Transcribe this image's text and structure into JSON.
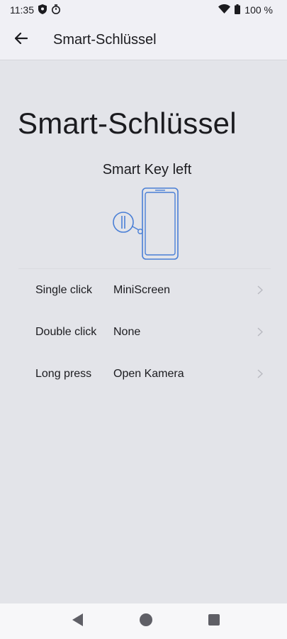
{
  "status_bar": {
    "time": "11:35",
    "battery": "100 %",
    "icons": [
      "shield-icon",
      "timer-icon",
      "wifi-icon",
      "battery-icon"
    ]
  },
  "app_bar": {
    "title": "Smart-Schlüssel",
    "back_icon": "arrow-left-icon"
  },
  "page": {
    "heading": "Smart-Schlüssel",
    "section_label": "Smart Key left"
  },
  "settings": {
    "rows": [
      {
        "label": "Single click",
        "value": "MiniScreen"
      },
      {
        "label": "Double click",
        "value": "None"
      },
      {
        "label": "Long press",
        "value": "Open Kamera"
      }
    ]
  },
  "nav_bar": {
    "icons": [
      "nav-back-icon",
      "nav-home-icon",
      "nav-recents-icon"
    ]
  },
  "colors": {
    "background": "#e3e4e9",
    "app_bar": "#f0f0f5",
    "accent_illustration": "#4a7fd6",
    "chevron": "#b8b9c0"
  }
}
